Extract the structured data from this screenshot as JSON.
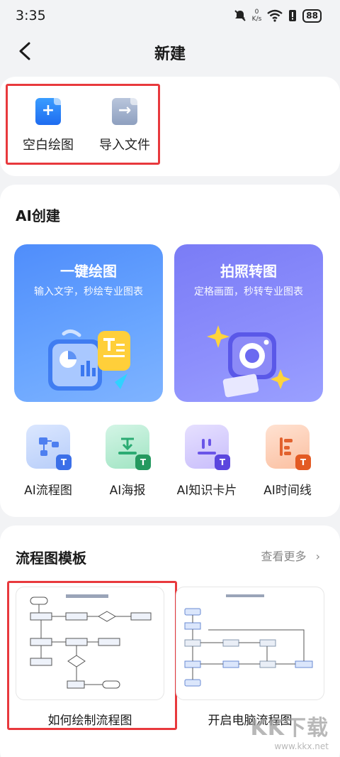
{
  "status": {
    "time": "3:35",
    "netspeed_value": "0",
    "netspeed_unit": "K/s",
    "battery": "88"
  },
  "header": {
    "title": "新建"
  },
  "quick": {
    "blank_label": "空白绘图",
    "import_label": "导入文件"
  },
  "ai": {
    "title": "AI创建",
    "card1": {
      "title": "一键绘图",
      "desc": "输入文字，秒绘专业图表"
    },
    "card2": {
      "title": "拍照转图",
      "desc": "定格画面，秒转专业图表"
    },
    "tools": [
      {
        "label": "AI流程图",
        "color": "#6b9cf5"
      },
      {
        "label": "AI海报",
        "color": "#44c28c"
      },
      {
        "label": "AI知识卡片",
        "color": "#8b7cf3"
      },
      {
        "label": "AI时间线",
        "color": "#f07a4a"
      }
    ]
  },
  "templates": {
    "title": "流程图模板",
    "more": "查看更多",
    "items": [
      {
        "label": "如何绘制流程图"
      },
      {
        "label": "开启电脑流程图"
      }
    ]
  },
  "watermark": {
    "logo": "KK下载",
    "url": "www.kkx.net"
  }
}
